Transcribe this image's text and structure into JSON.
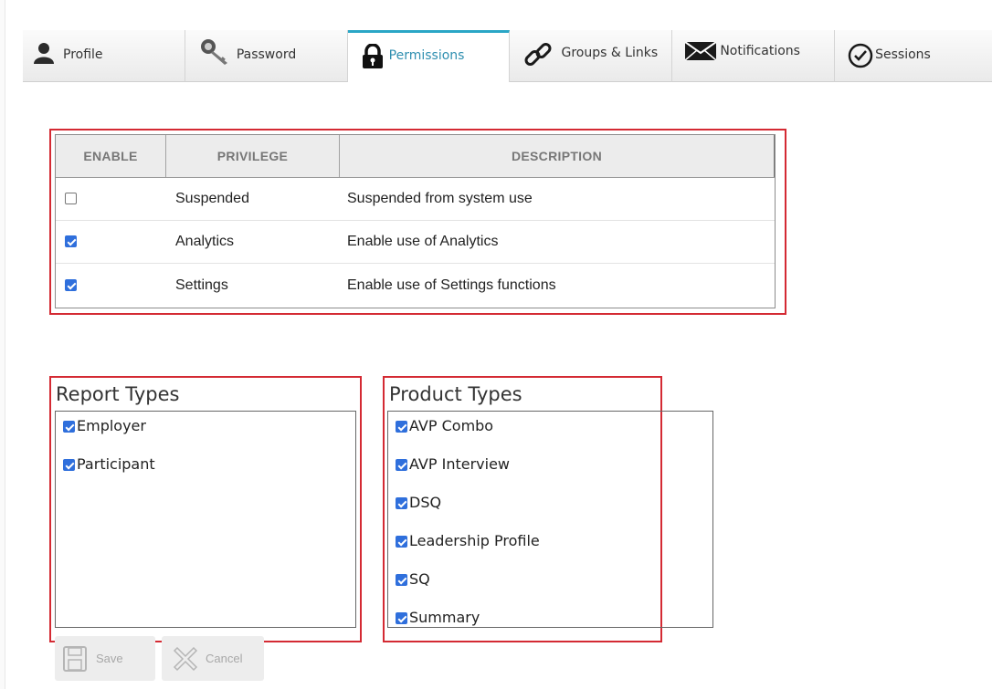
{
  "tabs": [
    {
      "label": "Profile",
      "icon": "person-icon",
      "active": false
    },
    {
      "label": "Password",
      "icon": "key-icon",
      "active": false
    },
    {
      "label": "Permissions",
      "icon": "lock-icon",
      "active": true
    },
    {
      "label": "Groups & Links",
      "icon": "link-icon",
      "active": false
    },
    {
      "label": "Notifications",
      "icon": "envelope-icon",
      "active": false
    },
    {
      "label": "Sessions",
      "icon": "clock-icon",
      "active": false
    }
  ],
  "permissions": {
    "headers": {
      "enable": "ENABLE",
      "privilege": "PRIVILEGE",
      "description": "DESCRIPTION"
    },
    "rows": [
      {
        "enabled": false,
        "privilege": "Suspended",
        "description": "Suspended from system use"
      },
      {
        "enabled": true,
        "privilege": "Analytics",
        "description": "Enable use of Analytics"
      },
      {
        "enabled": true,
        "privilege": "Settings",
        "description": "Enable use of Settings functions"
      }
    ]
  },
  "report_types": {
    "title": "Report Types",
    "items": [
      {
        "label": "Employer",
        "checked": true
      },
      {
        "label": "Participant",
        "checked": true
      }
    ]
  },
  "product_types": {
    "title": "Product Types",
    "items": [
      {
        "label": "AVP Combo",
        "checked": true
      },
      {
        "label": "AVP Interview",
        "checked": true
      },
      {
        "label": "DSQ",
        "checked": true
      },
      {
        "label": "Leadership Profile",
        "checked": true
      },
      {
        "label": "SQ",
        "checked": true
      },
      {
        "label": "Summary",
        "checked": true
      }
    ]
  },
  "actions": {
    "save_label": "Save",
    "cancel_label": "Cancel"
  },
  "colors": {
    "accent": "#2aa6c6",
    "highlight": "#d42a33",
    "checkbox": "#2f6fdc",
    "disabled_text": "#a8a8a8"
  }
}
